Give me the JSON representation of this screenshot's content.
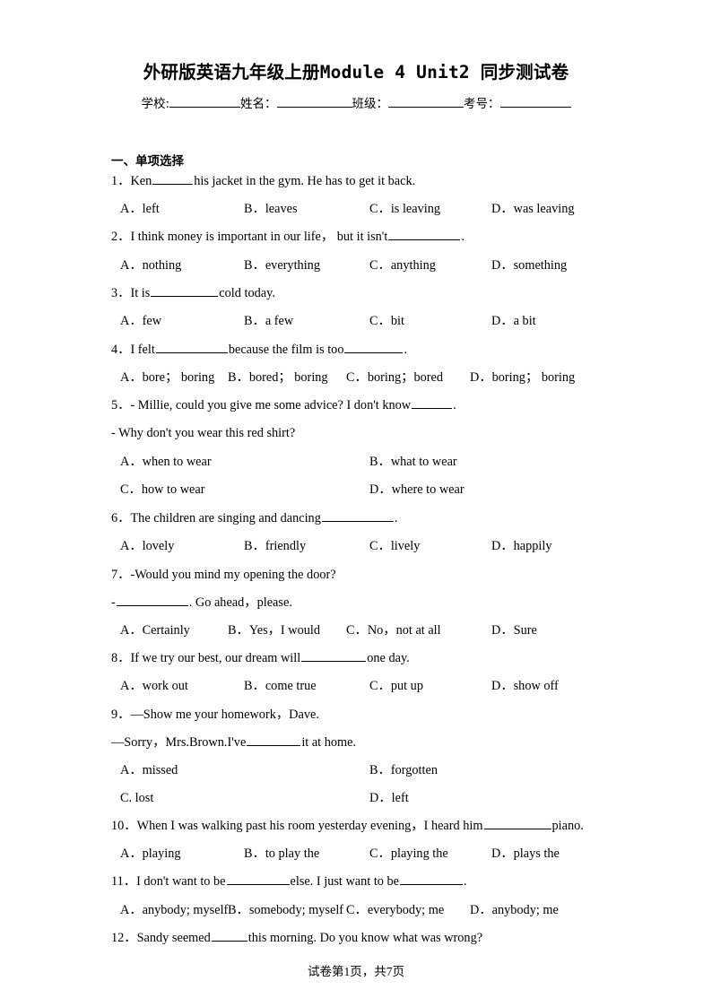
{
  "title": "外研版英语九年级上册Module 4 Unit2 同步测试卷",
  "info": {
    "school_label": "学校:",
    "name_label": "姓名：",
    "class_label": "班级：",
    "exam_no_label": "考号："
  },
  "section": {
    "heading": "一、单项选择"
  },
  "questions": [
    {
      "number": "1",
      "stem_before": "1．Ken",
      "stem_after": "his jacket in the gym. He has to get it back.",
      "options": [
        "A．left",
        "B．leaves",
        "C．is leaving",
        "D．was leaving"
      ]
    },
    {
      "number": "2",
      "stem_before": "2．I think money is important in our life，   but it isn't",
      "stem_after": ".",
      "options": [
        "A．nothing",
        "B．everything",
        "C．anything",
        "D．something"
      ]
    },
    {
      "number": "3",
      "stem_before": "3．It is",
      "stem_after": "cold today.",
      "options": [
        "A．few",
        "B．a few",
        "C．bit",
        "D．a bit"
      ]
    },
    {
      "number": "4",
      "stem_before": "4．I felt",
      "stem_mid": "because the film is too",
      "stem_after": ".",
      "options": [
        "A．bore； boring",
        "B．bored； boring",
        "C．boring；bored",
        "D．boring； boring"
      ]
    },
    {
      "number": "5",
      "stem_before": "5．- Millie, could you give me some advice? I don't know",
      "stem_after": ".",
      "stem_line2": "- Why don't you wear this red shirt?",
      "options": [
        "A．when to wear",
        "B．what to wear",
        "C．how to wear",
        "D．where to wear"
      ]
    },
    {
      "number": "6",
      "stem_before": "6．The children are singing and dancing",
      "stem_after": ".",
      "options": [
        "A．lovely",
        "B．friendly",
        "C．lively",
        "D．happily"
      ]
    },
    {
      "number": "7",
      "stem_before": "7．-Would you mind my opening the door?",
      "stem_line2_before": "-",
      "stem_line2_after": ". Go ahead，please.",
      "options": [
        "A．Certainly",
        "B．Yes，I would",
        "C．No，not at all",
        "D．Sure"
      ]
    },
    {
      "number": "8",
      "stem_before": "8．If we try our best, our dream will",
      "stem_after": "one day.",
      "options": [
        "A．work out",
        "B．come true",
        "C．put up",
        "D．show off"
      ]
    },
    {
      "number": "9",
      "stem_before": "9．—Show me your homework，Dave.",
      "stem_line2_before": "—Sorry，Mrs.Brown.I've",
      "stem_line2_after": "it at home.",
      "options": [
        "A．missed",
        "B．forgotten",
        "C. lost",
        "D．left"
      ]
    },
    {
      "number": "10",
      "stem_before": "10．When I was walking past his room yesterday evening，I heard him",
      "stem_after": "piano.",
      "options": [
        "A．playing",
        "B．to play the",
        "C．playing the",
        "D．plays the"
      ]
    },
    {
      "number": "11",
      "stem_before": "11．I don't want to be",
      "stem_mid": "else. I just want to be",
      "stem_after": ".",
      "options": [
        "A．anybody; myself",
        "B．somebody; myself",
        "C．everybody; me",
        "D．anybody; me"
      ]
    },
    {
      "number": "12",
      "stem_before": "12．Sandy seemed",
      "stem_after": "this morning. Do you know what was wrong?",
      "options": []
    }
  ],
  "footer": {
    "prefix": "试卷第",
    "page": "1",
    "middle": "页，共",
    "total": "7",
    "suffix": "页"
  }
}
